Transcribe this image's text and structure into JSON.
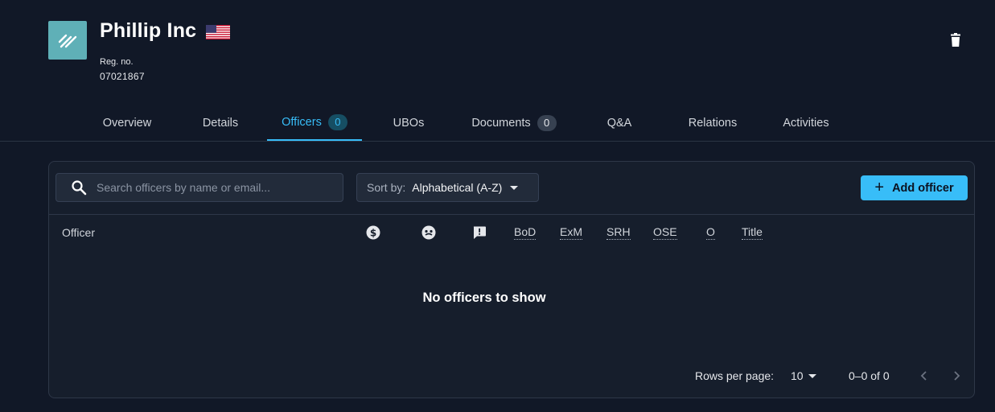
{
  "company": {
    "name": "Phillip Inc",
    "flag_icon": "us-flag-icon",
    "reg_label": "Reg. no.",
    "reg_value": "07021867",
    "logo_color": "#5fb0b7"
  },
  "tabs": [
    {
      "label": "Overview",
      "badge": null
    },
    {
      "label": "Details",
      "badge": null
    },
    {
      "label": "Officers",
      "badge": "0",
      "active": true
    },
    {
      "label": "UBOs",
      "badge": null
    },
    {
      "label": "Documents",
      "badge": "0"
    },
    {
      "label": "Q&A",
      "badge": null
    },
    {
      "label": "Relations",
      "badge": null
    },
    {
      "label": "Activities",
      "badge": null
    }
  ],
  "toolbar": {
    "search_placeholder": "Search officers by name or email...",
    "sort_label": "Sort by:",
    "sort_value": "Alphabetical (A-Z)",
    "add_label": "Add officer"
  },
  "table": {
    "columns": [
      "Officer",
      "BoD",
      "ExM",
      "SRH",
      "OSE",
      "O",
      "Title"
    ],
    "icon_columns": [
      "dollar-circle-icon",
      "face-icon",
      "alert-message-icon"
    ],
    "empty_message": "No officers to show"
  },
  "pagination": {
    "rows_label": "Rows per page:",
    "rows_value": "10",
    "range": "0–0 of 0"
  },
  "colors": {
    "background": "#111827",
    "accent": "#38bdf8",
    "panel": "#161e2c"
  }
}
